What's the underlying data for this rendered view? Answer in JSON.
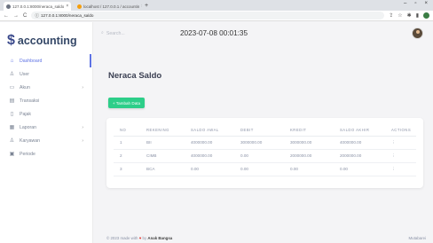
{
  "browser": {
    "tabs": [
      {
        "label": "127.0.0.1:8000/neraca_saldo",
        "active": true
      },
      {
        "label": "localhost / 127.0.0.1 / accountin",
        "active": false
      }
    ],
    "url": "127.0.0.1:8000/neraca_saldo"
  },
  "brand": {
    "name": "accounting",
    "symbol": "$"
  },
  "sidebar": {
    "items": [
      {
        "label": "Dashboard",
        "icon": "home-icon",
        "active": true,
        "caret": false
      },
      {
        "label": "User",
        "icon": "user-icon",
        "active": false,
        "caret": false
      },
      {
        "label": "Akun",
        "icon": "folder-icon",
        "active": false,
        "caret": true
      },
      {
        "label": "Transaksi",
        "icon": "receipt-icon",
        "active": false,
        "caret": false
      },
      {
        "label": "Pajak",
        "icon": "document-icon",
        "active": false,
        "caret": false
      },
      {
        "label": "Laporan",
        "icon": "report-icon",
        "active": false,
        "caret": true
      },
      {
        "label": "Karyawan",
        "icon": "people-icon",
        "active": false,
        "caret": true
      },
      {
        "label": "Periode",
        "icon": "calendar-icon",
        "active": false,
        "caret": false
      }
    ]
  },
  "topbar": {
    "search_placeholder": "Search...",
    "datetime": "2023-07-08 00:01:35"
  },
  "page": {
    "title": "Neraca Saldo",
    "add_button": "+ Tambah Data"
  },
  "table": {
    "headers": [
      "NO",
      "REKENING",
      "SALDO AWAL",
      "DEBIT",
      "KREDIT",
      "SALDO AKHIR",
      "ACTIONS"
    ],
    "rows": [
      [
        "1",
        "BII",
        "4000000.00",
        "3000000.00",
        "3000000.00",
        "4000000.00",
        "⋮"
      ],
      [
        "2",
        "CIMB",
        "4000000.00",
        "0.00",
        "2000000.00",
        "2000000.00",
        "⋮"
      ],
      [
        "3",
        "BCA",
        "0.00",
        "0.00",
        "0.00",
        "0.00",
        "⋮"
      ]
    ]
  },
  "footer": {
    "prefix": "© 2023 made with",
    "by": "by",
    "author": "Anak Bangsa",
    "right": "Mutabarei"
  }
}
